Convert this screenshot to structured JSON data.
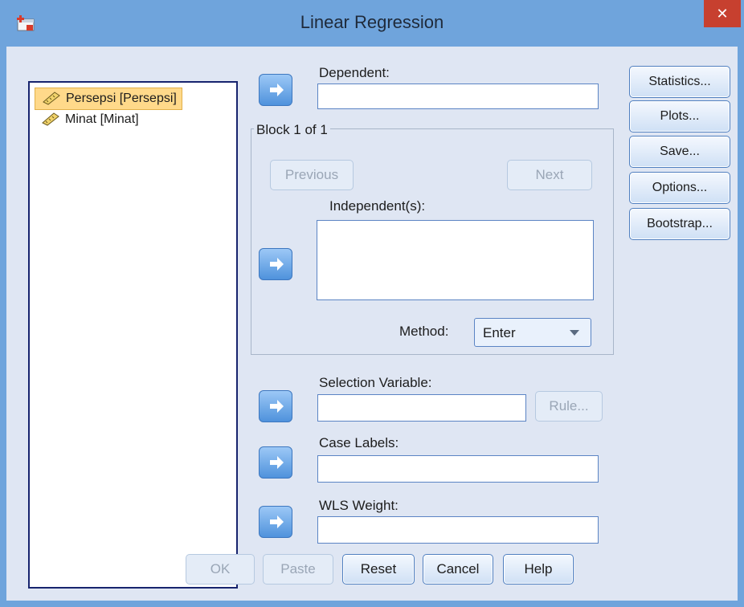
{
  "window": {
    "title": "Linear Regression",
    "close_glyph": "✕"
  },
  "variables": [
    {
      "label": "Persepsi [Persepsi]",
      "selected": true,
      "icon": "ruler-icon"
    },
    {
      "label": "Minat [Minat]",
      "selected": false,
      "icon": "ruler-icon"
    }
  ],
  "dependent": {
    "label": "Dependent:",
    "value": ""
  },
  "block": {
    "title": "Block 1 of 1",
    "previous_label": "Previous",
    "next_label": "Next",
    "independent_label": "Independent(s):",
    "method_label": "Method:",
    "method_value": "Enter"
  },
  "selection": {
    "label": "Selection Variable:",
    "rule_label": "Rule..."
  },
  "case_labels": {
    "label": "Case Labels:"
  },
  "wls": {
    "label": "WLS Weight:"
  },
  "side_buttons": {
    "statistics": "Statistics...",
    "plots": "Plots...",
    "save": "Save...",
    "options": "Options...",
    "bootstrap": "Bootstrap..."
  },
  "bottom_buttons": {
    "ok": "OK",
    "paste": "Paste",
    "reset": "Reset",
    "cancel": "Cancel",
    "help": "Help"
  },
  "colors": {
    "titlebar": "#6fa4dc",
    "client": "#dfe6f3",
    "close": "#c7402f",
    "selection": "#ffd98a",
    "arrow_button": "#4f92dc"
  }
}
